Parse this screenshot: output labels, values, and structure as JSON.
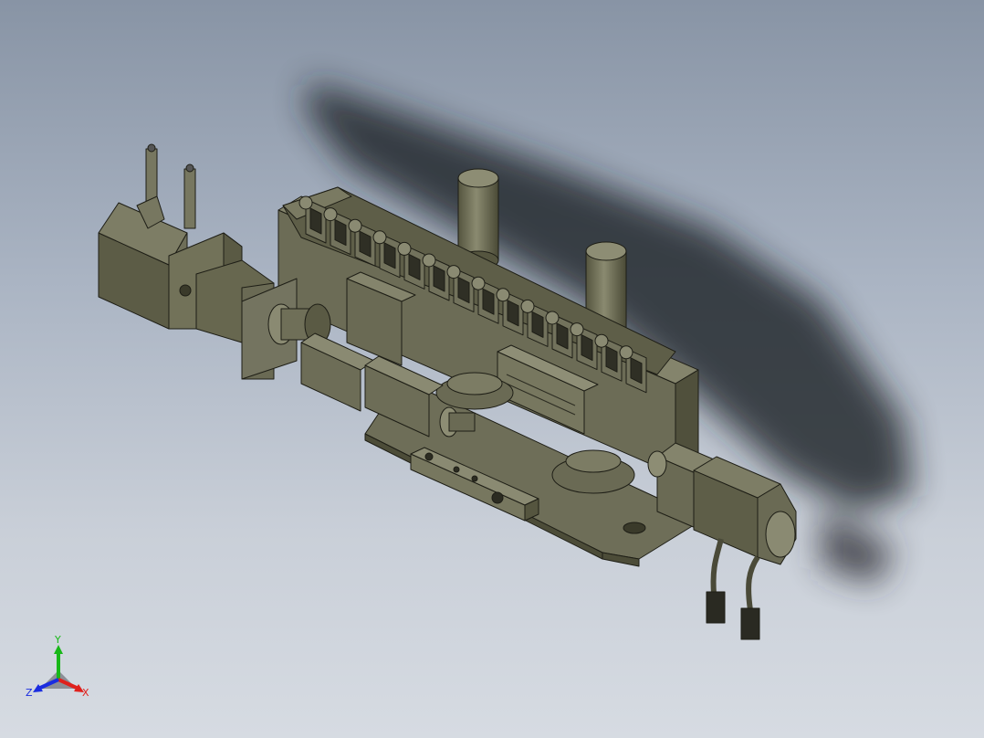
{
  "viewport": {
    "background_top": "#8894a5",
    "background_bottom": "#d6dbe2",
    "model_color": "#6e6e58",
    "model_shade": "#55553f",
    "model_edge": "#1e1e16"
  },
  "triad": {
    "x_label": "X",
    "y_label": "Y",
    "z_label": "Z",
    "x_color": "#e0201c",
    "y_color": "#18b818",
    "z_color": "#1a2ce0"
  }
}
